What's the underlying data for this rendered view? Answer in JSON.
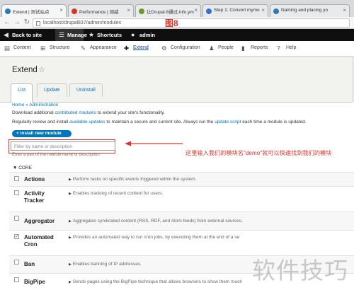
{
  "browser": {
    "tabs": [
      {
        "label": "Extend | 测试站点"
      },
      {
        "label": "Performance | 测威"
      },
      {
        "label": "让Drupal 8通过.info.ym"
      },
      {
        "label": "Step 1: Convert mymo"
      },
      {
        "label": "Naming and placing yo"
      }
    ],
    "url": "localhost/drupal837/admin/modules",
    "figure_label": "图8"
  },
  "toolbar": {
    "back_to_site": "Back to site",
    "manage": "Manage",
    "shortcuts": "Shortcuts",
    "user": "admin"
  },
  "admin_menu": [
    {
      "label": "Content"
    },
    {
      "label": "Structure"
    },
    {
      "label": "Appearance"
    },
    {
      "label": "Extend"
    },
    {
      "label": "Configuration"
    },
    {
      "label": "People"
    },
    {
      "label": "Reports"
    },
    {
      "label": "Help"
    }
  ],
  "page": {
    "title": "Extend",
    "tabs": [
      {
        "label": "List"
      },
      {
        "label": "Update"
      },
      {
        "label": "Uninstall"
      }
    ],
    "breadcrumb": "Home » Administration",
    "para1": {
      "before": "Download additional ",
      "link": "contributed modules",
      "after": " to extend your site's functionality."
    },
    "para2": {
      "before": "Regularly review and install ",
      "link1": "available updates",
      "middle": " to maintain a secure and current site. Always run the ",
      "link2": "update script",
      "after": " each time a module is updated."
    },
    "install_button": "+ Install new module",
    "filter_placeholder": "Filter by name or description",
    "filter_help": "Enter a part of the module name or description",
    "annotation_note": "这里输入我们的模块名\"demo\"就可以快速找到我们的模块",
    "section_label": "▼ CORE"
  },
  "modules": [
    {
      "name": "Actions",
      "description": "Perform tasks on specific events triggered within the system.",
      "checked": false
    },
    {
      "name": "Activity Tracker",
      "description": "Enables tracking of recent content for users.",
      "checked": false
    },
    {
      "name": "Aggregator",
      "description": "Aggregates syndicated content (RSS, RDF, and Atom feeds) from external sources.",
      "checked": false
    },
    {
      "name": "Automated Cron",
      "description": "Provides an automated way to run cron jobs, by executing them at the end of a se",
      "checked": true
    },
    {
      "name": "Ban",
      "description": "Enables banning of IP addresses.",
      "checked": false
    },
    {
      "name": "BigPipe",
      "description": "Sends pages using the BigPipe technique that allows browsers to show them much",
      "checked": false
    }
  ],
  "watermark": "软件技巧",
  "colors": {
    "link": "#0074bd",
    "annotation": "#e0332a",
    "toolbar": "#0f0f0f"
  }
}
